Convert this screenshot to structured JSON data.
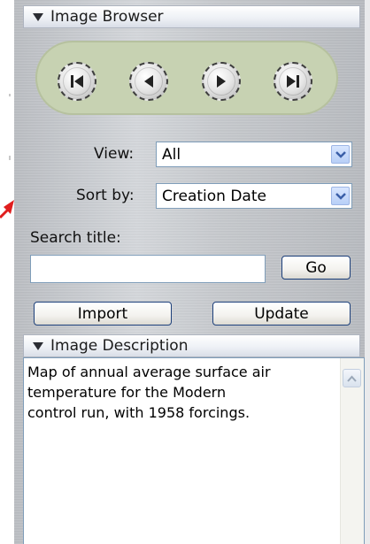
{
  "image_browser": {
    "title": "Image Browser",
    "nav_buttons": [
      "first",
      "previous",
      "next",
      "last"
    ]
  },
  "filters": {
    "view_label": "View:",
    "view_value": "All",
    "sort_label": "Sort by:",
    "sort_value": "Creation Date"
  },
  "search": {
    "label": "Search title:",
    "value": "",
    "go_label": "Go"
  },
  "actions": {
    "import_label": "Import",
    "update_label": "Update"
  },
  "image_description": {
    "title": "Image Description",
    "text": "Map of annual average surface air\ntemperature for the Modern\ncontrol run, with 1958 forcings."
  },
  "colors": {
    "pill": "#c7d2b2",
    "accent_arrow": "#e01e1e",
    "button_border": "#1c3f7a"
  }
}
